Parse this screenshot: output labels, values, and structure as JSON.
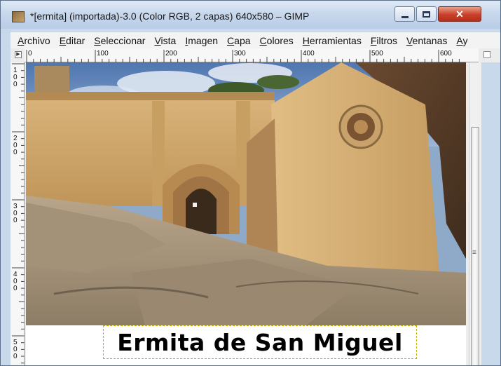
{
  "window": {
    "title": "*[ermita] (importada)-3.0 (Color RGB, 2 capas) 640x580 – GIMP",
    "min_icon": "minimize-icon",
    "max_icon": "maximize-icon",
    "close_icon": "close-icon",
    "close_glyph": "✕"
  },
  "menubar": {
    "items": [
      {
        "u": "A",
        "rest": "rchivo"
      },
      {
        "u": "E",
        "rest": "ditar"
      },
      {
        "u": "S",
        "rest": "eleccionar"
      },
      {
        "u": "V",
        "rest": "ista"
      },
      {
        "u": "I",
        "rest": "magen"
      },
      {
        "u": "C",
        "rest": "apa"
      },
      {
        "u": "C",
        "rest": "olores"
      },
      {
        "u": "H",
        "rest": "erramientas"
      },
      {
        "u": "F",
        "rest": "iltros"
      },
      {
        "u": "V",
        "rest": "entanas"
      },
      {
        "u": "A",
        "rest": "y"
      }
    ]
  },
  "rulers": {
    "horizontal_labels": [
      "0",
      "100",
      "200",
      "300",
      "400",
      "500",
      "600"
    ],
    "vertical_labels": [
      "100",
      "200",
      "300",
      "400",
      "500"
    ]
  },
  "canvas": {
    "caption": "Ermita de San Miguel"
  },
  "colors": {
    "sky": "#5f86bc",
    "stone": "#d2aa6a",
    "caption_border": "#c9b300"
  }
}
